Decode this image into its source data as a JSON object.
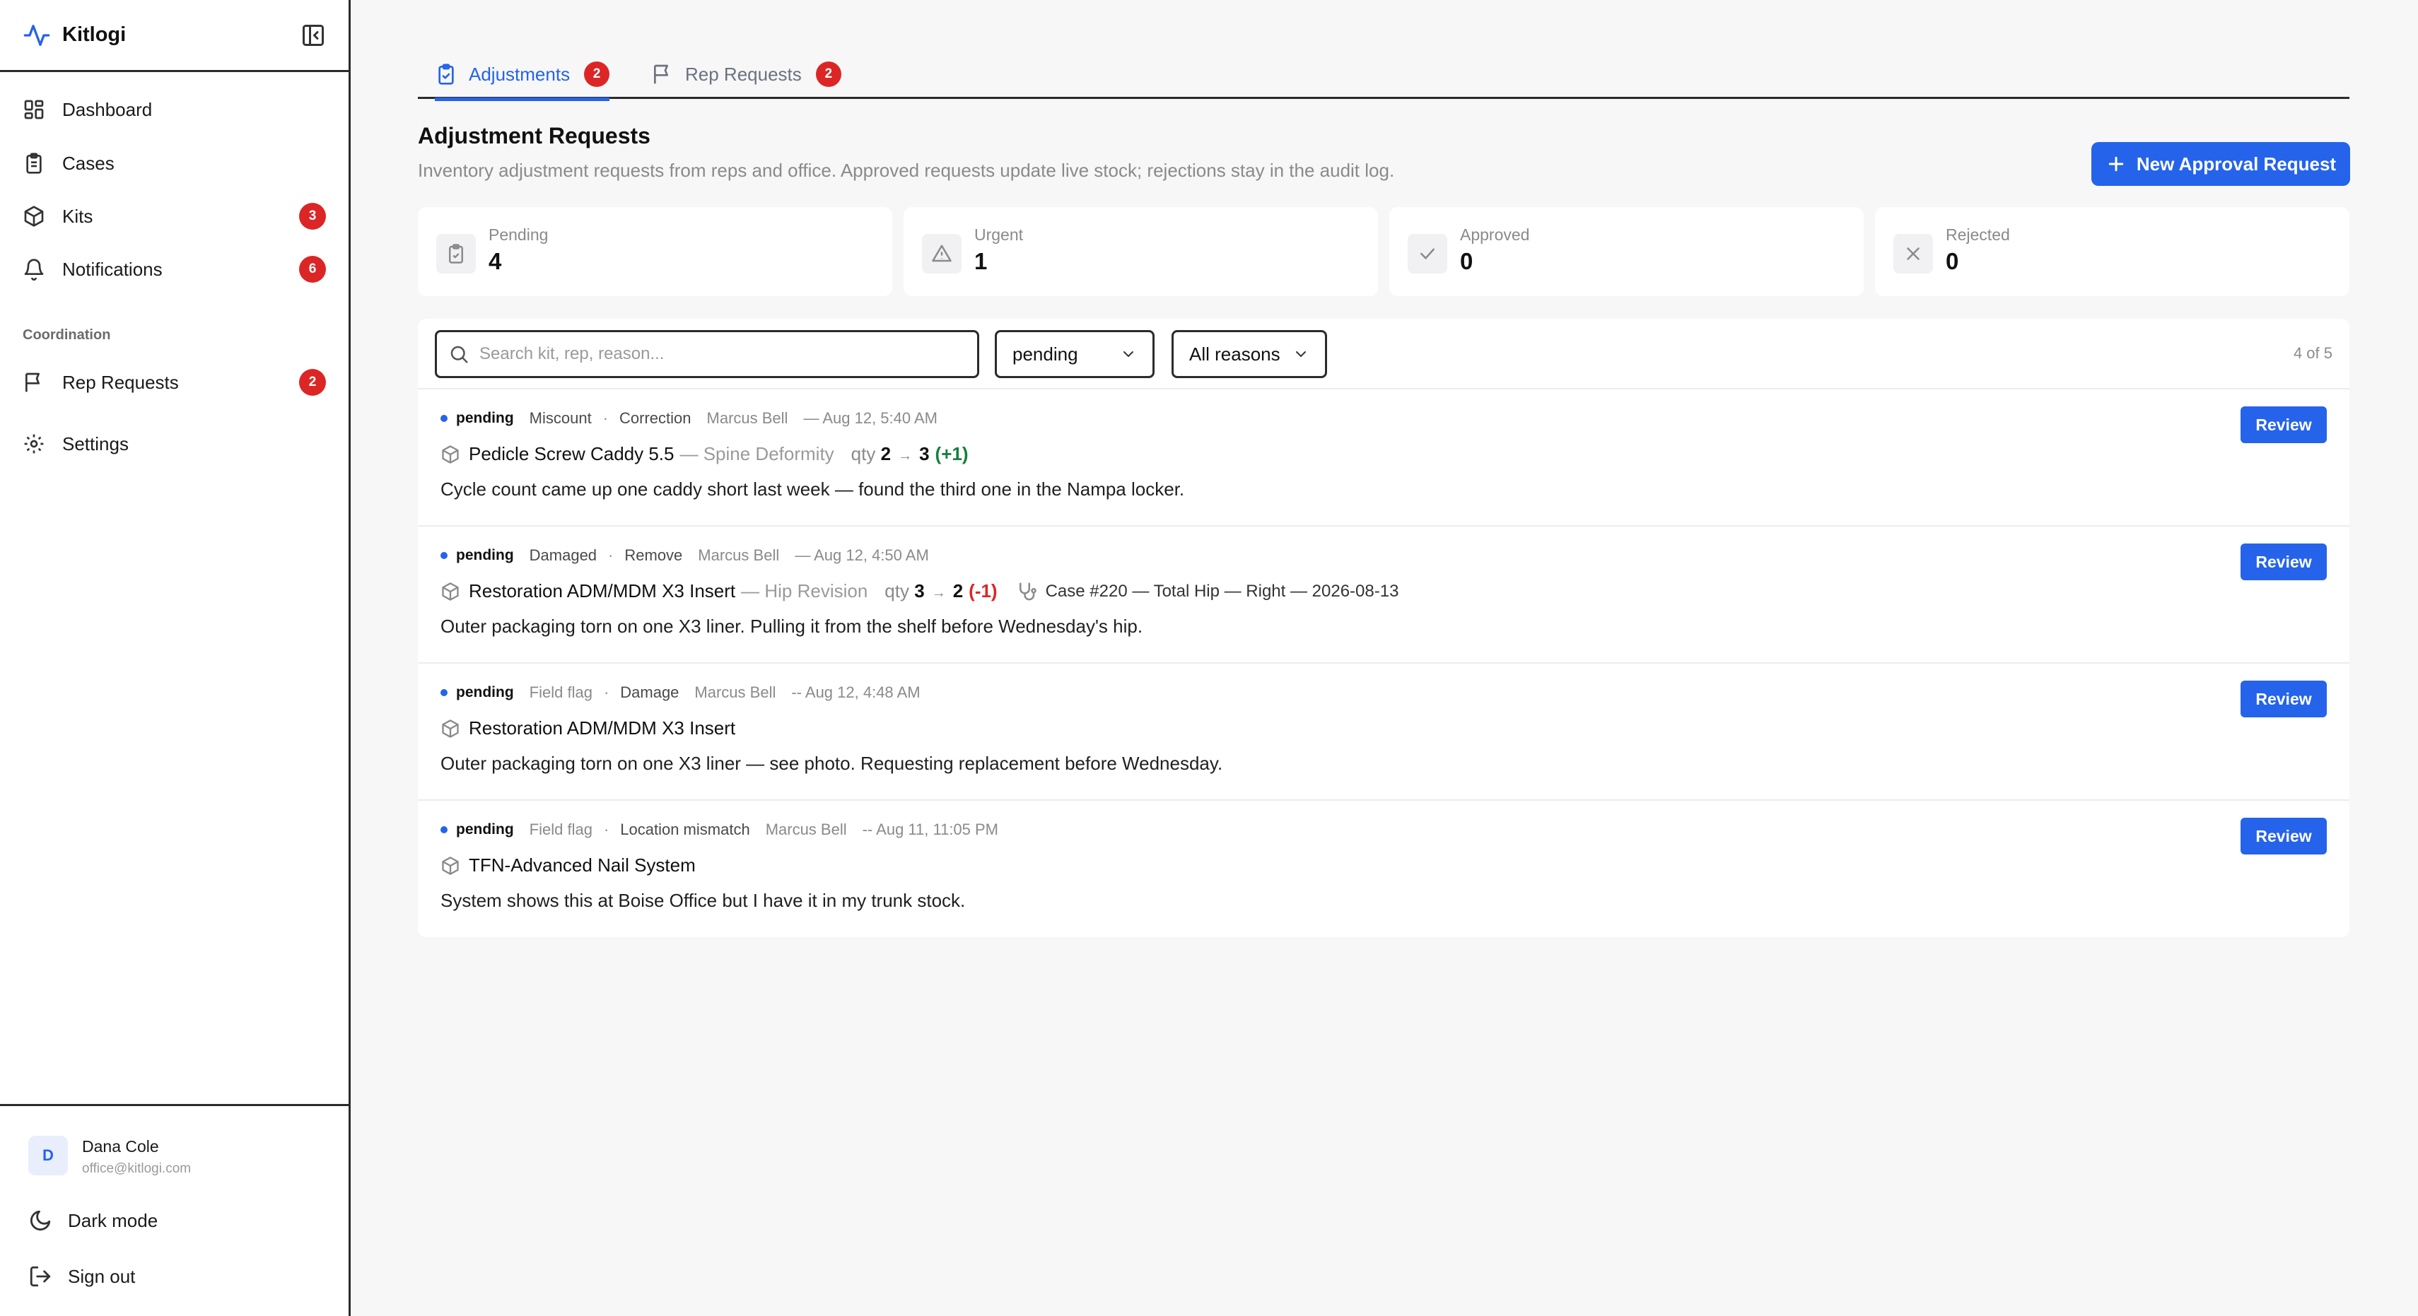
{
  "app": {
    "name": "Kitlogi"
  },
  "sidebar": {
    "items": [
      {
        "label": "Dashboard",
        "icon": "dashboard-icon"
      },
      {
        "label": "Cases",
        "icon": "clipboard-icon"
      },
      {
        "label": "Kits",
        "icon": "package-icon",
        "badge": "3"
      },
      {
        "label": "Notifications",
        "icon": "bell-icon",
        "badge": "6"
      }
    ],
    "section_label": "Coordination",
    "coordination_items": [
      {
        "label": "Rep Requests",
        "icon": "flag-icon",
        "badge": "2"
      }
    ],
    "settings_label": "Settings",
    "user": {
      "initial": "D",
      "name": "Dana Cole",
      "email": "office@kitlogi.com"
    },
    "dark_mode_label": "Dark mode",
    "sign_out_label": "Sign out"
  },
  "tabs": [
    {
      "label": "Adjustments",
      "badge": "2",
      "active": true
    },
    {
      "label": "Rep Requests",
      "badge": "2",
      "active": false
    }
  ],
  "header": {
    "title": "Adjustment Requests",
    "subtitle": "Inventory adjustment requests from reps and office. Approved requests update live stock; rejections stay in the audit log.",
    "new_button_label": "New Approval Request"
  },
  "stats": [
    {
      "label": "Pending",
      "value": "4",
      "icon": "clipboard-check-icon"
    },
    {
      "label": "Urgent",
      "value": "1",
      "icon": "warning-icon"
    },
    {
      "label": "Approved",
      "value": "0",
      "icon": "check-icon"
    },
    {
      "label": "Rejected",
      "value": "0",
      "icon": "x-icon"
    }
  ],
  "filters": {
    "search_placeholder": "Search kit, rep, reason...",
    "status_value": "pending",
    "reason_value": "All reasons",
    "count_text": "4 of 5"
  },
  "requests": [
    {
      "status": "pending",
      "type": "Miscount",
      "reason": "Correction",
      "rep": "Marcus Bell",
      "time": "— Aug 12, 5:40 AM",
      "kit": "Pedicle Screw Caddy 5.5",
      "procedure": "— Spine Deformity",
      "qty_label": "qty",
      "qty_from": "2",
      "qty_to": "3",
      "delta": "(+1)",
      "delta_sign": "pos",
      "case": "",
      "description": "Cycle count came up one caddy short last week — found the third one in the Nampa locker.",
      "action": "Review"
    },
    {
      "status": "pending",
      "type": "Damaged",
      "reason": "Remove",
      "rep": "Marcus Bell",
      "time": "— Aug 12, 4:50 AM",
      "kit": "Restoration ADM/MDM X3 Insert",
      "procedure": "— Hip Revision",
      "qty_label": "qty",
      "qty_from": "3",
      "qty_to": "2",
      "delta": "(-1)",
      "delta_sign": "neg",
      "case": "Case #220 — Total Hip — Right — 2026-08-13",
      "description": "Outer packaging torn on one X3 liner. Pulling it from the shelf before Wednesday's hip.",
      "action": "Review"
    },
    {
      "status": "pending",
      "type": "Field flag",
      "reason": "Damage",
      "rep": "Marcus Bell",
      "time": "-- Aug 12, 4:48 AM",
      "kit": "Restoration ADM/MDM X3 Insert",
      "procedure": "",
      "qty_label": "",
      "qty_from": "",
      "qty_to": "",
      "delta": "",
      "delta_sign": "",
      "case": "",
      "description": "Outer packaging torn on one X3 liner — see photo. Requesting replacement before Wednesday.",
      "action": "Review"
    },
    {
      "status": "pending",
      "type": "Field flag",
      "reason": "Location mismatch",
      "rep": "Marcus Bell",
      "time": "-- Aug 11, 11:05 PM",
      "kit": "TFN-Advanced Nail System",
      "procedure": "",
      "qty_label": "",
      "qty_from": "",
      "qty_to": "",
      "delta": "",
      "delta_sign": "",
      "case": "",
      "description": "System shows this at Boise Office but I have it in my trunk stock.",
      "action": "Review"
    }
  ],
  "colors": {
    "accent": "#2563eb",
    "badge": "#dc2626",
    "positive": "#15803d",
    "negative": "#dc2626"
  }
}
